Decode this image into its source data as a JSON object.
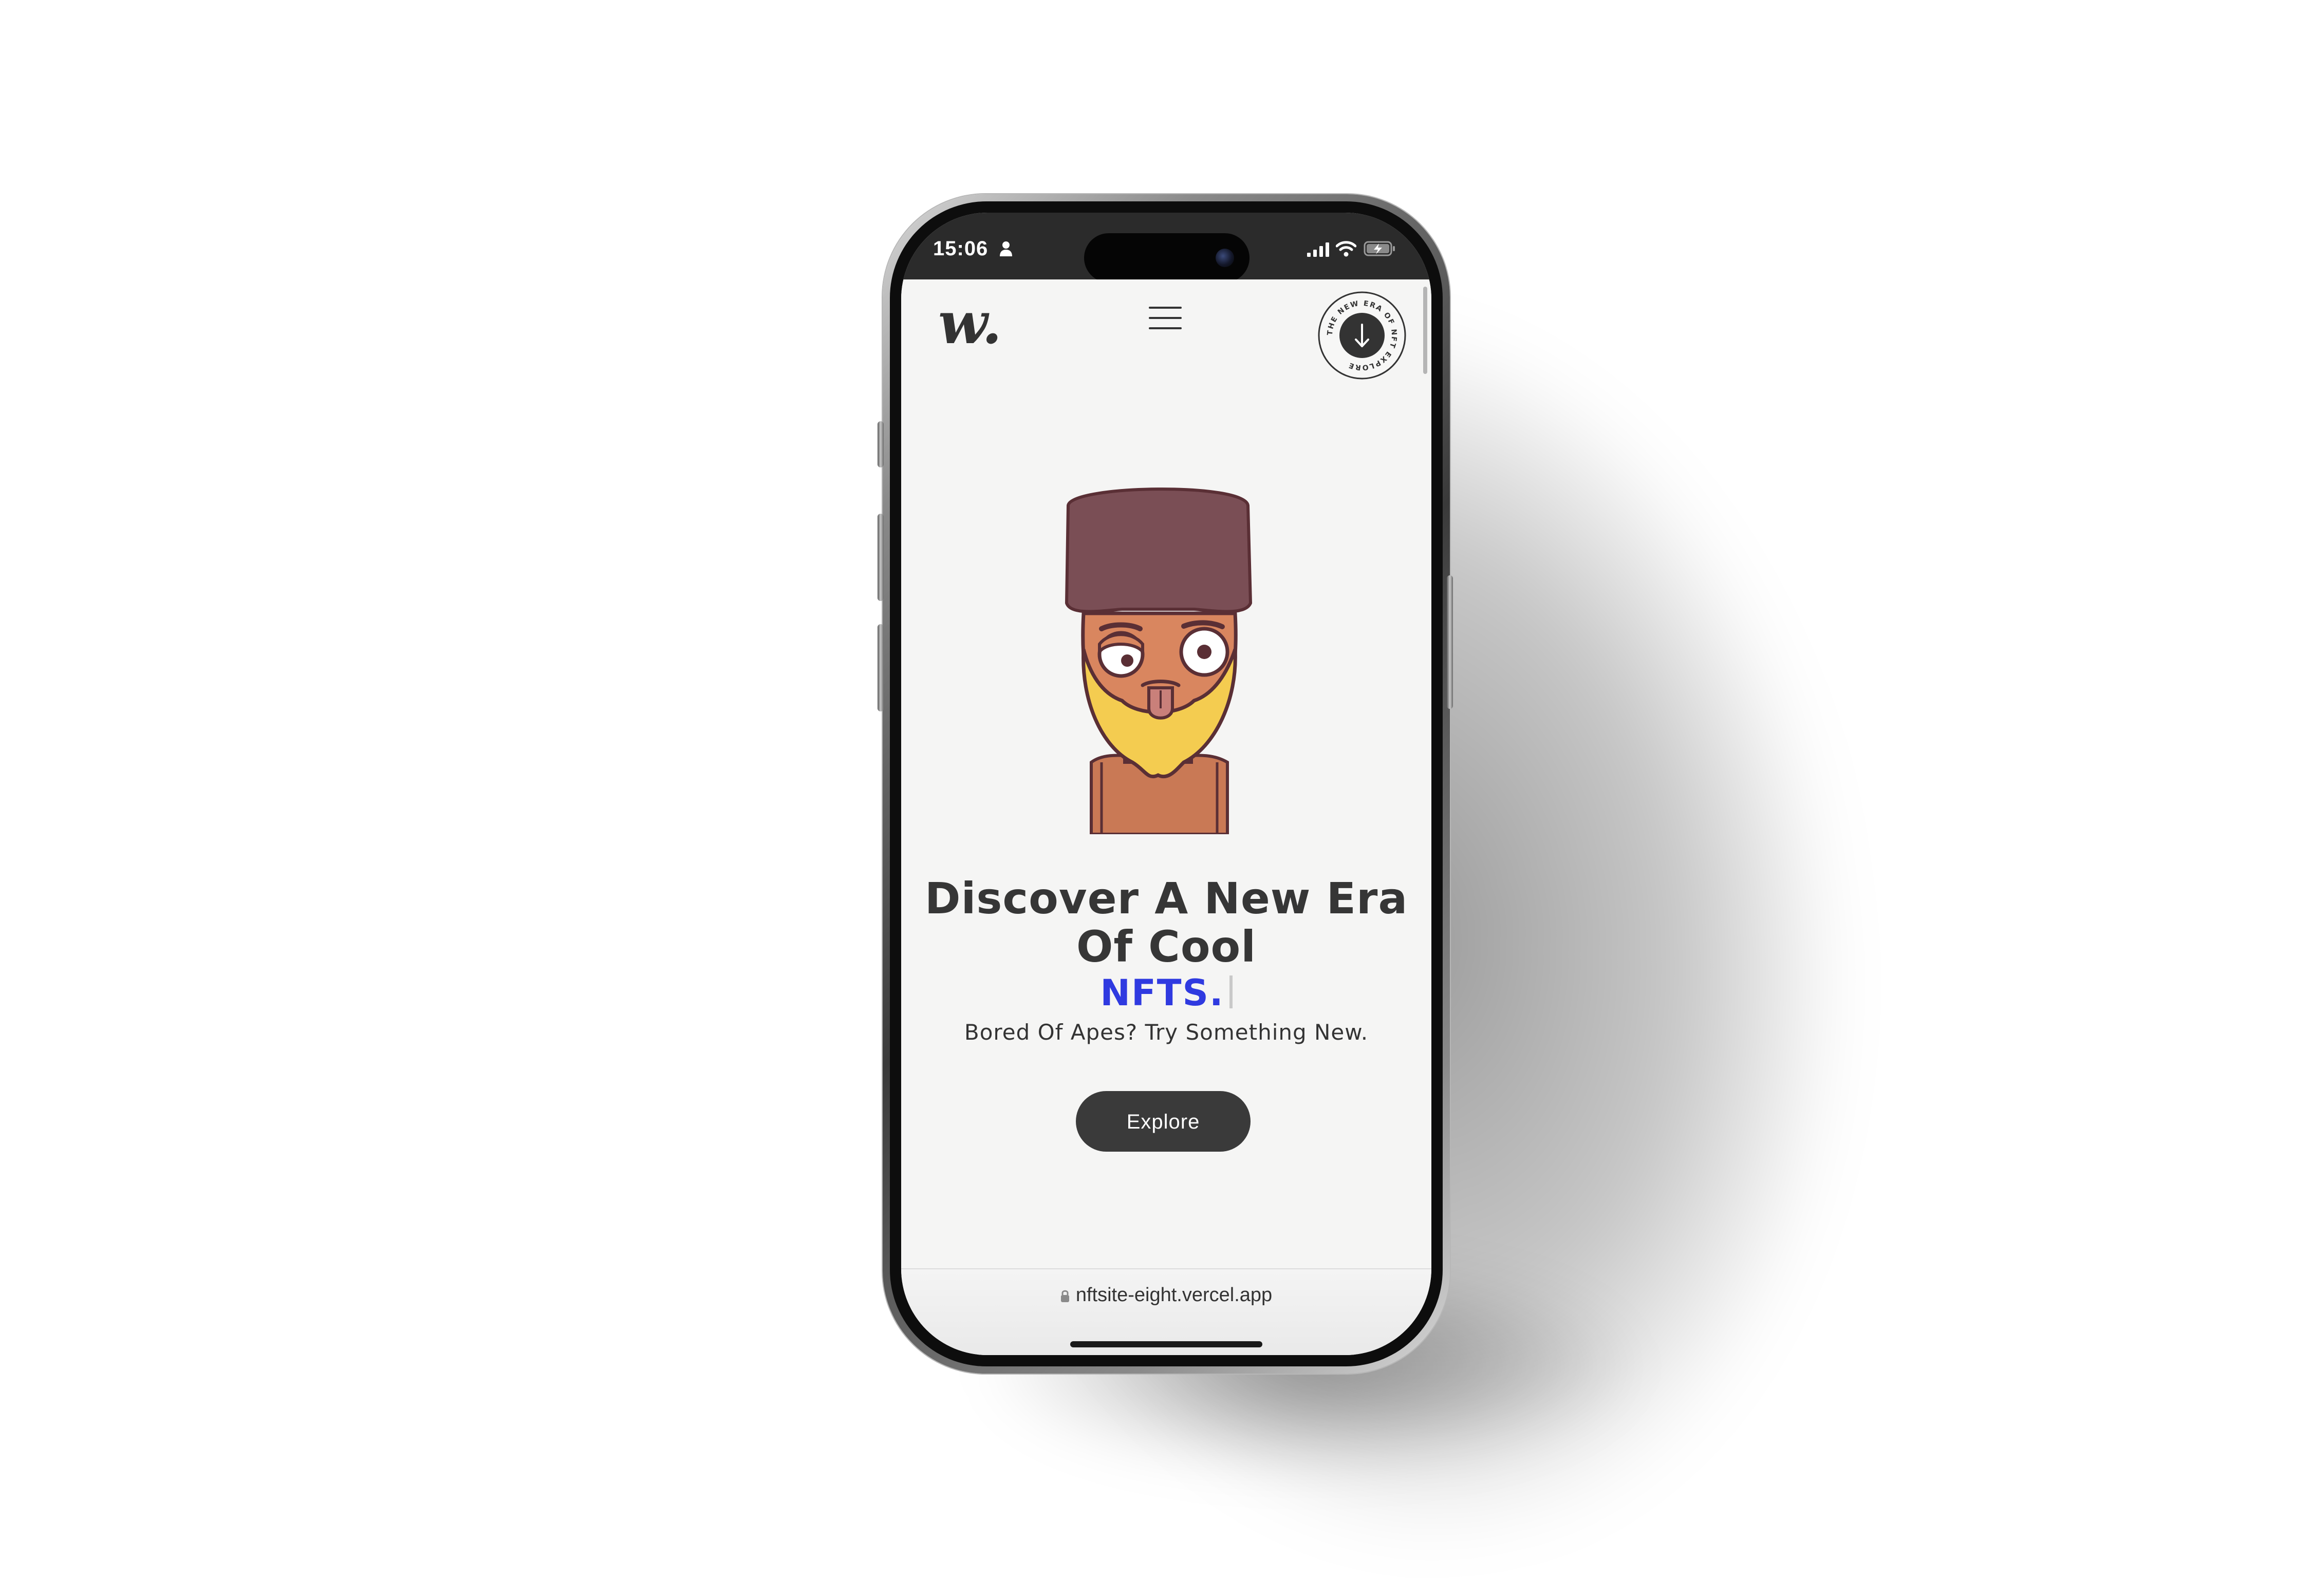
{
  "status_bar": {
    "time": "15:06",
    "icons": [
      "person-icon",
      "signal-icon",
      "wifi-icon",
      "battery-charging-icon"
    ]
  },
  "header": {
    "logo": "w.",
    "menu_icon": "hamburger-menu-icon",
    "badge": {
      "text": "THE NEW ERA OF NFT EXPLORE",
      "icon": "arrow-down-icon"
    }
  },
  "hero": {
    "image": "nft-avatar-character-icon",
    "headline": "Discover A New Era Of Cool",
    "highlight": "NFTS.",
    "subtitle": "Bored Of Apes? Try Something New.",
    "cta_label": "Explore"
  },
  "browser": {
    "url": "nftsite-eight.vercel.app",
    "lock_icon": "lock-icon"
  },
  "colors": {
    "accent": "#2f3ae0",
    "button": "#3a3a3a",
    "page_background": "#f5f5f4",
    "status_bar": "#2b2b2b"
  }
}
